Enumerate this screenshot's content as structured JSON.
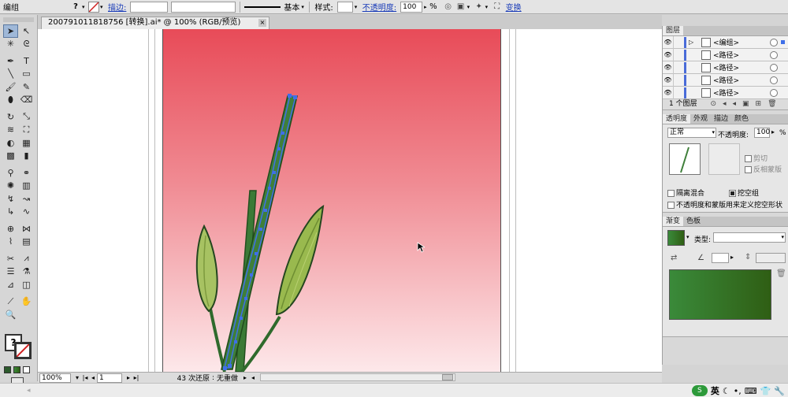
{
  "control_bar": {
    "group_label": "编组",
    "help_icon": "?",
    "stroke_label": "描边:",
    "stroke_value": "",
    "brush_value": "",
    "stroke_profile_label": "基本",
    "style_label": "样式:",
    "opacity_label": "不透明度:",
    "opacity_value": "100",
    "percent": "%",
    "transform_label": "变换"
  },
  "document_tab": {
    "title": "200791011818756 [转换].ai* @ 100% (RGB/预览)",
    "close_glyph": "×"
  },
  "tools": [
    {
      "name": "selection-tool",
      "glyph": "➤",
      "active": true
    },
    {
      "name": "direct-selection-tool",
      "glyph": "↖",
      "active": false
    },
    {
      "name": "magic-wand-tool",
      "glyph": "✳"
    },
    {
      "name": "lasso-tool",
      "glyph": "ᘓ"
    },
    {
      "name": "pen-tool",
      "glyph": "✒"
    },
    {
      "name": "type-tool",
      "glyph": "T"
    },
    {
      "name": "line-tool",
      "glyph": "╲"
    },
    {
      "name": "rectangle-tool",
      "glyph": "▭"
    },
    {
      "name": "paintbrush-tool",
      "glyph": "🖌"
    },
    {
      "name": "pencil-tool",
      "glyph": "✎"
    },
    {
      "name": "blob-brush-tool",
      "glyph": "⬮"
    },
    {
      "name": "eraser-tool",
      "glyph": "⌫"
    },
    {
      "name": "rotate-tool",
      "glyph": "↻"
    },
    {
      "name": "scale-tool",
      "glyph": "⤡"
    },
    {
      "name": "warp-tool",
      "glyph": "≋"
    },
    {
      "name": "free-transform-tool",
      "glyph": "⛶"
    },
    {
      "name": "shape-builder-tool",
      "glyph": "◐"
    },
    {
      "name": "perspective-grid-tool",
      "glyph": "▦"
    },
    {
      "name": "mesh-tool",
      "glyph": "▩"
    },
    {
      "name": "gradient-tool",
      "glyph": "▮"
    },
    {
      "name": "eyedropper-tool",
      "glyph": "⚲"
    },
    {
      "name": "blend-tool",
      "glyph": "⚭"
    },
    {
      "name": "symbol-sprayer-tool",
      "glyph": "✺"
    },
    {
      "name": "column-graph-tool",
      "glyph": "▥"
    },
    {
      "name": "path-tool-a",
      "glyph": "↯"
    },
    {
      "name": "path-tool-b",
      "glyph": "↝"
    },
    {
      "name": "path-tool-c",
      "glyph": "↳"
    },
    {
      "name": "path-tool-d",
      "glyph": "∿"
    },
    {
      "name": "target-tool",
      "glyph": "⊕"
    },
    {
      "name": "artboard-tool-a",
      "glyph": "⋈"
    },
    {
      "name": "artboard-tool-b",
      "glyph": "⌇"
    },
    {
      "name": "grid-tool",
      "glyph": "▤"
    },
    {
      "name": "scissors-tool",
      "glyph": "✂"
    },
    {
      "name": "zigzag-tool",
      "glyph": "⩘"
    },
    {
      "name": "list-tool",
      "glyph": "☰"
    },
    {
      "name": "eyedropper-tool-b",
      "glyph": "⚗"
    },
    {
      "name": "measure-tool",
      "glyph": "⊿"
    },
    {
      "name": "slice-tool",
      "glyph": "◫"
    },
    {
      "name": "knife-tool",
      "glyph": "⟋"
    },
    {
      "name": "hand-tool",
      "glyph": "✋"
    },
    {
      "name": "zoom-tool",
      "glyph": "🔍"
    }
  ],
  "status_bar": {
    "zoom": "100%",
    "page": "1",
    "undo_status": "43 次还原",
    "redo_status": "无重做"
  },
  "layers_panel": {
    "tab": "图层",
    "rows": [
      {
        "name": "<编组>",
        "expand": "▷"
      },
      {
        "name": "<路径>",
        "expand": ""
      },
      {
        "name": "<路径>",
        "expand": ""
      },
      {
        "name": "<路径>",
        "expand": ""
      },
      {
        "name": "<路径>",
        "expand": ""
      }
    ],
    "footer": "1 个图层"
  },
  "transparency_panel": {
    "tabs": [
      "透明度",
      "外观",
      "描边",
      "颜色"
    ],
    "blend_mode": "正常",
    "opacity_label": "不透明度:",
    "opacity_value": "100",
    "percent": "%",
    "clip_label": "剪切",
    "invert_mask_label": "反相蒙版",
    "isolate_blend_label": "隔离混合",
    "knockout_group_label": "挖空组",
    "define_knockout_label": "不透明度和蒙版用来定义挖空形状"
  },
  "gradient_panel": {
    "tabs": [
      "渐变",
      "色板"
    ],
    "type_label": "类型:",
    "type_value": "",
    "angle_value": ""
  },
  "taskbar": {
    "lang": "英"
  },
  "colors": {
    "selection_blue": "#3f6fe8",
    "stem_green": "#3f7f3a",
    "bud_green": "#9bbd58",
    "gradient_start": "#3a8a3a",
    "gradient_end": "#2f5e14",
    "artboard_top": "#e84b58",
    "artboard_bottom": "#fde8ea"
  }
}
